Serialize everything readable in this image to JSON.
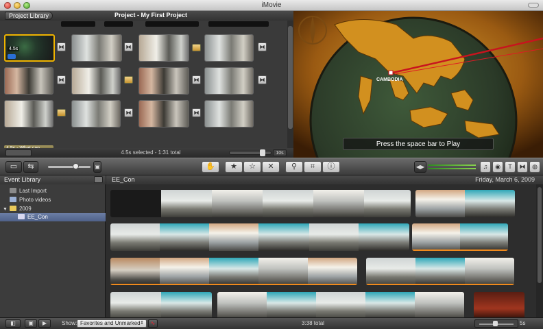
{
  "window": {
    "title": "iMovie"
  },
  "project": {
    "library_button": "Project Library",
    "title": "Project - My First Project",
    "clip_duration_badge": "4.5s",
    "title_clip_label": "4.5s - What can...",
    "status": "4.5s selected - 1:31 total",
    "zoom_duration": "10s"
  },
  "viewer": {
    "hint": "Press the space bar to Play",
    "map_label": "CAMBODIA"
  },
  "toolbar": {
    "icons": [
      "camera-import-icon",
      "swap-icon",
      "thumbnail-size-icon",
      "voiceover-icon",
      "favorite-star-icon",
      "unmark-star-icon",
      "reject-x-icon",
      "keyword-icon",
      "crop-icon",
      "inspector-icon",
      "music-icon",
      "photo-icon",
      "title-icon",
      "transition-icon",
      "map-icon"
    ]
  },
  "event_library": {
    "header": "Event Library",
    "items": [
      {
        "label": "Last Import"
      },
      {
        "label": "Photo videos"
      },
      {
        "label": "2009"
      },
      {
        "label": "EE_Con"
      }
    ]
  },
  "event_browser": {
    "event_name": "EE_Con",
    "date": "Friday, March 6, 2009"
  },
  "bottom": {
    "show_label": "Show:",
    "filter_value": "Favorites and Unmarked",
    "total": "3:38 total",
    "duration": "5s"
  },
  "colors": {
    "selection_accent": "#f0b400",
    "marked_orange": "#f08a1c",
    "selected_event": "#5a6e99"
  }
}
